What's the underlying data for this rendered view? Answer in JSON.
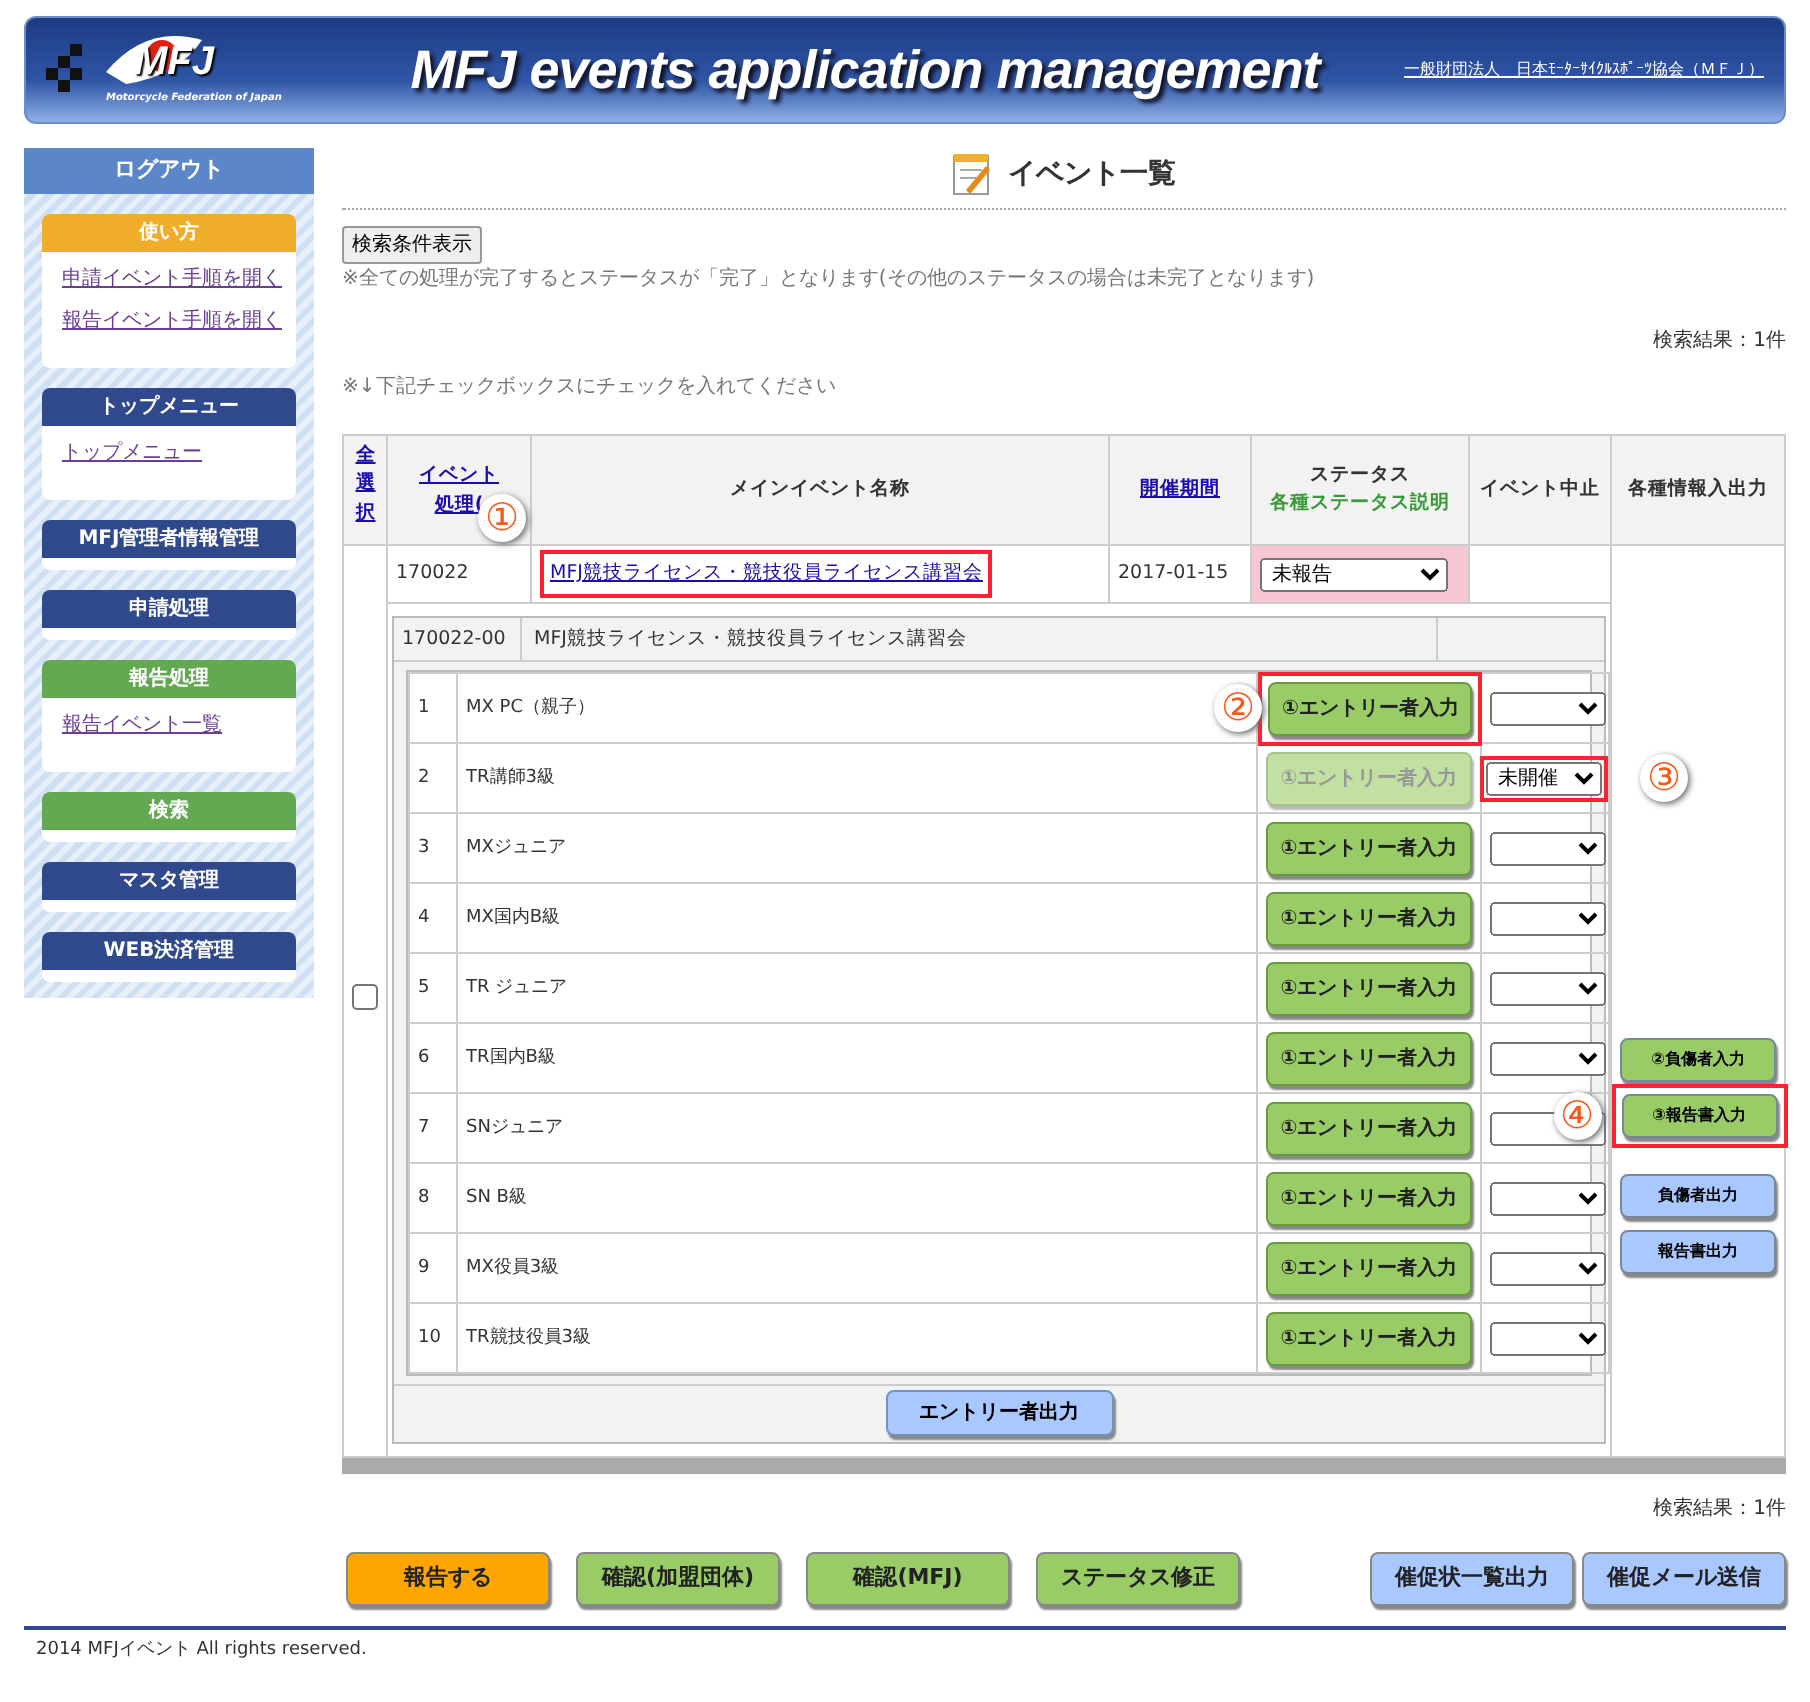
{
  "header": {
    "logo_text": "MFJ",
    "logo_subtitle": "Motorcycle Federation of Japan",
    "title": "MFJ events application management",
    "org_link": "一般財団法人　日本ﾓｰﾀｰｻｲｸﾙｽﾎﾟｰﾂ協会（ＭＦＪ）"
  },
  "sidebar": {
    "logout": "ログアウト",
    "sections": [
      {
        "title": "使い方",
        "color": "#f0ad2a",
        "links": [
          "申請イベント手順を開く",
          "報告イベント手順を開く"
        ]
      },
      {
        "title": "トップメニュー",
        "color": "#30498c",
        "links": [
          "トップメニュー"
        ]
      },
      {
        "title": "MFJ管理者情報管理",
        "color": "#30498c"
      },
      {
        "title": "申請処理",
        "color": "#30498c"
      },
      {
        "title": "報告処理",
        "color": "#62a951",
        "links": [
          "報告イベント一覧"
        ]
      },
      {
        "title": "検索",
        "color": "#62a951"
      },
      {
        "title": "マスタ管理",
        "color": "#30498c"
      },
      {
        "title": "WEB決済管理",
        "color": "#30498c"
      }
    ]
  },
  "page_title": "イベント一覧",
  "search_toggle": "検索条件表示",
  "note": "※全ての処理が完了するとステータスが「完了」となります(その他のステータスの場合は未完了となります)",
  "result_count_top": "検索結果：1件",
  "checkbox_note": "※↓下記チェックボックスにチェックを入れてください",
  "table": {
    "columns": [
      {
        "label": "全選択",
        "kind": "vertical-link"
      },
      {
        "label": "イベント",
        "label2": "処理(",
        "kind": "link"
      },
      {
        "label": "メインイベント名称",
        "kind": "text"
      },
      {
        "label": "開催期間",
        "kind": "link"
      },
      {
        "label": "ステータス",
        "note": "各種ステータス説明",
        "kind": "text"
      },
      {
        "label": "イベント中止",
        "kind": "text"
      },
      {
        "label": "各種情報入出力",
        "kind": "text"
      }
    ],
    "event": {
      "id": "170022",
      "name": "MFJ競技ライセンス・競技役員ライセンス講習会",
      "callout": "①",
      "date": "2017-01-15",
      "status": "未報告",
      "checked": false
    },
    "sub_event": {
      "id": "170022-00",
      "name": "MFJ競技ライセンス・競技役員ライセンス講習会"
    },
    "classes": [
      {
        "no": "1",
        "name": "MX PC（親子）",
        "entry_button": "①エントリー者入力",
        "disabled": false,
        "button_callout": "②"
      },
      {
        "no": "2",
        "name": "TR講師3級",
        "entry_button": "①エントリー者入力",
        "disabled": true,
        "cancel": "未開催",
        "cancel_callout": "③"
      },
      {
        "no": "3",
        "name": "MXジュニア",
        "entry_button": "①エントリー者入力",
        "disabled": false
      },
      {
        "no": "4",
        "name": "MX国内B級",
        "entry_button": "①エントリー者入力",
        "disabled": false
      },
      {
        "no": "5",
        "name": "TR ジュニア",
        "entry_button": "①エントリー者入力",
        "disabled": false
      },
      {
        "no": "6",
        "name": "TR国内B級",
        "entry_button": "①エントリー者入力",
        "disabled": false
      },
      {
        "no": "7",
        "name": "SNジュニア",
        "entry_button": "①エントリー者入力",
        "disabled": false
      },
      {
        "no": "8",
        "name": "SN B級",
        "entry_button": "①エントリー者入力",
        "disabled": false
      },
      {
        "no": "9",
        "name": "MX役員3級",
        "entry_button": "①エントリー者入力",
        "disabled": false
      },
      {
        "no": "10",
        "name": "TR競技役員3級",
        "entry_button": "①エントリー者入力",
        "disabled": false
      }
    ],
    "entry_output_button": "エントリー者出力",
    "io_buttons": [
      {
        "label": "②負傷者入力",
        "kind": "input"
      },
      {
        "label": "③報告書入力",
        "kind": "input",
        "callout": "④"
      },
      {
        "label": "負傷者出力",
        "kind": "output"
      },
      {
        "label": "報告書出力",
        "kind": "output"
      }
    ]
  },
  "result_count_bottom": "検索結果：1件",
  "actions_left": [
    {
      "label": "報告する",
      "color": "#ffa500"
    },
    {
      "label": "確認(加盟団体)",
      "color": "#99cc66"
    },
    {
      "label": "確認(MFJ)",
      "color": "#99cc66"
    },
    {
      "label": "ステータス修正",
      "color": "#99cc66"
    }
  ],
  "actions_right": [
    {
      "label": "催促状一覧出力",
      "color": "#a8c8ff"
    },
    {
      "label": "催促メール送信",
      "color": "#a8c8ff"
    }
  ],
  "footer": "2014 MFJイベント All rights reserved."
}
